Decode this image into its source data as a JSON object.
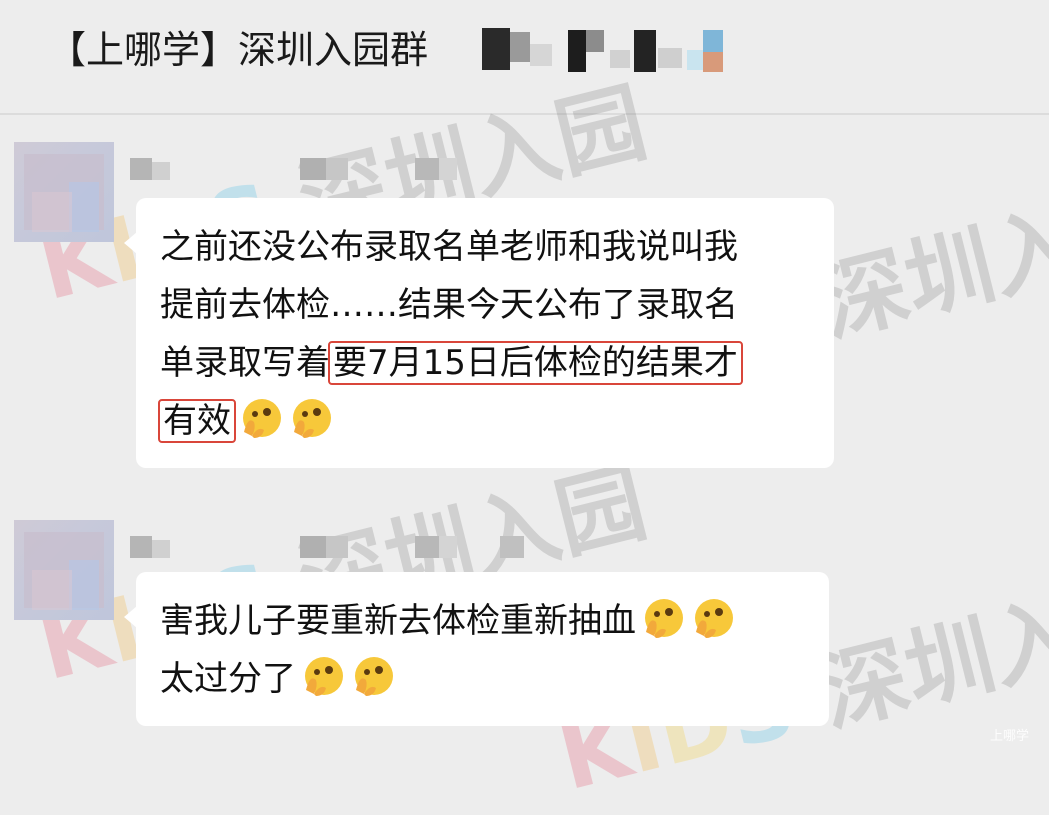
{
  "header": {
    "title": "【上哪学】深圳入园群"
  },
  "watermark": {
    "brand": "KIDS",
    "text": "深圳入园",
    "colors": {
      "k": "#e23a5a",
      "i": "#f2a71a",
      "d": "#f5c518",
      "s": "#2bb6e6",
      "cn": "#6d6d6d"
    }
  },
  "messages": [
    {
      "lines": [
        "之前还没公布录取名单老师和我说叫我",
        "提前去体检……结果今天公布了录取名",
        "单录取写着"
      ],
      "highlight_part1": "要7月15日后体检的结果才",
      "highlight_part2": "有效",
      "emoji": [
        "peeking-face-emoji",
        "peeking-face-emoji"
      ]
    },
    {
      "lines": [
        "害我儿子要重新去体检重新抽血",
        "太过分了"
      ],
      "emoji_line1": [
        "peeking-face-emoji",
        "peeking-face-emoji"
      ],
      "emoji_line2": [
        "peeking-face-emoji",
        "peeking-face-emoji"
      ]
    }
  ],
  "corner_mark": "上哪学",
  "colors": {
    "background": "#ededed",
    "bubble": "#ffffff",
    "highlight_border": "#d9463a"
  }
}
